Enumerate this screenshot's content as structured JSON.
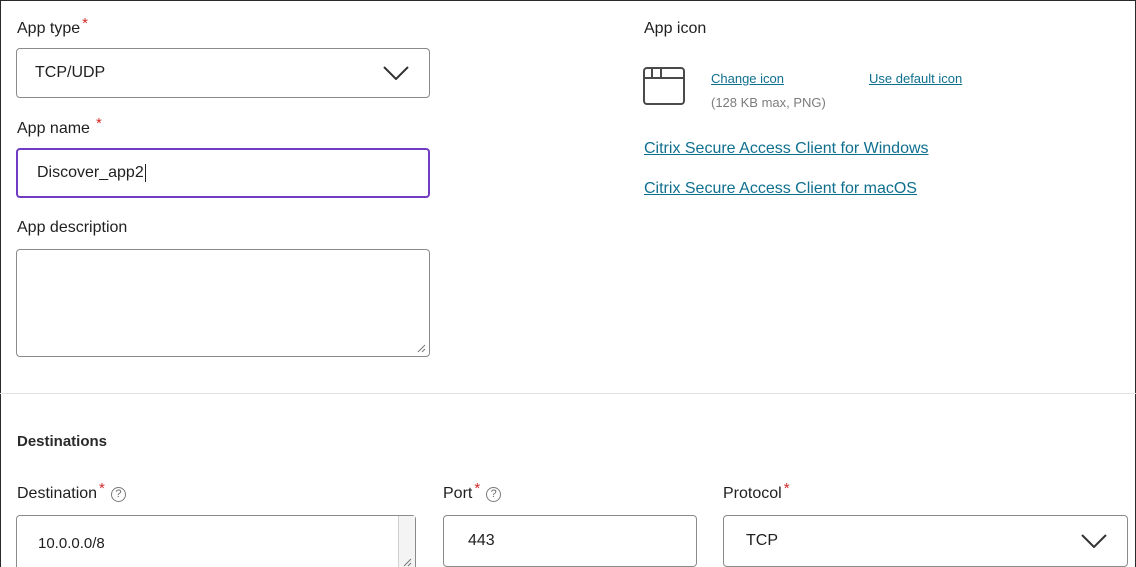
{
  "app_type": {
    "label": "App type",
    "value": "TCP/UDP",
    "required_mark": "*"
  },
  "app_name": {
    "label": "App name",
    "value": "Discover_app2",
    "required_mark": "*"
  },
  "app_description": {
    "label": "App description",
    "value": ""
  },
  "app_icon": {
    "label": "App icon",
    "change_link": "Change icon",
    "default_link": "Use default icon",
    "hint": "(128 KB max, PNG)"
  },
  "client_links": {
    "windows": "Citrix Secure Access Client for Windows",
    "macos": "Citrix Secure Access Client for macOS"
  },
  "destinations": {
    "section_title": "Destinations",
    "destination": {
      "label": "Destination",
      "value": "10.0.0.0/8",
      "required_mark": "*",
      "help": "?"
    },
    "port": {
      "label": "Port",
      "value": "443",
      "required_mark": "*",
      "help": "?"
    },
    "protocol": {
      "label": "Protocol",
      "value": "TCP",
      "required_mark": "*"
    }
  },
  "colors": {
    "focus": "#6f3cc3",
    "link": "#0f6f8f",
    "required": "#d22a2a"
  }
}
